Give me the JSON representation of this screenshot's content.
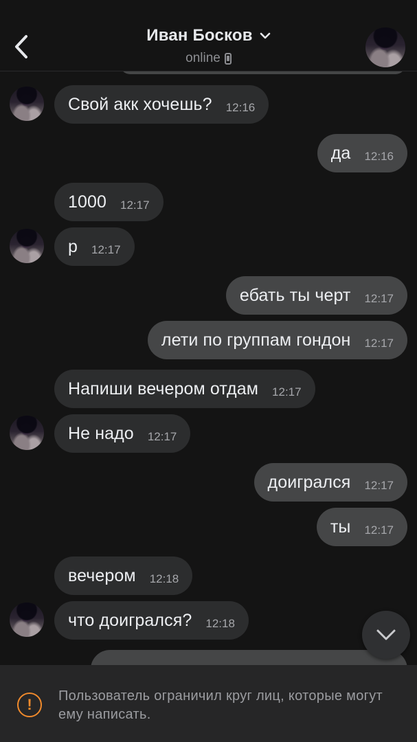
{
  "header": {
    "name": "Иван Босков",
    "status": "online"
  },
  "messages": [
    {
      "dir": "in",
      "text": "Свой акк хочешь?",
      "time": "12:16"
    },
    {
      "dir": "out",
      "text": "да",
      "time": "12:16"
    },
    {
      "dir": "in",
      "text": "1000",
      "time": "12:17"
    },
    {
      "dir": "in",
      "text": "р",
      "time": "12:17"
    },
    {
      "dir": "out",
      "text": "ебать ты черт",
      "time": "12:17"
    },
    {
      "dir": "out",
      "text": "лети по группам гондон",
      "time": "12:17"
    },
    {
      "dir": "in",
      "text": "Напиши вечером отдам",
      "time": "12:17"
    },
    {
      "dir": "in",
      "text": "Не надо",
      "time": "12:17"
    },
    {
      "dir": "out",
      "text": "доигрался",
      "time": "12:17"
    },
    {
      "dir": "out",
      "text": "ты",
      "time": "12:17"
    },
    {
      "dir": "in",
      "text": "вечером",
      "time": "12:18"
    },
    {
      "dir": "in",
      "text": "что доигрался?",
      "time": "12:18"
    }
  ],
  "footer": {
    "notice": "Пользователь ограничил круг лиц, которые могут ему написать."
  },
  "icons": {
    "back": "chevron-left-icon",
    "title_dropdown": "chevron-down-icon",
    "device": "phone-icon",
    "scroll_down": "chevron-down-icon",
    "warning": "exclamation-circle-icon"
  },
  "colors": {
    "background": "#141414",
    "incoming_bubble": "#2c2d2e",
    "outgoing_bubble": "#454647",
    "warning": "#f08a2c"
  }
}
